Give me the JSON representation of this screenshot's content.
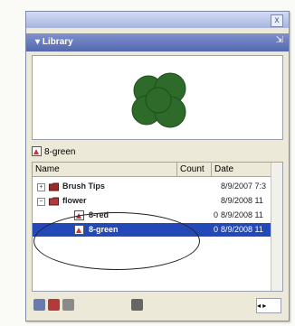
{
  "panel": {
    "title": "Library",
    "close_label": "x",
    "options_label": "⇲"
  },
  "selected_item": {
    "name": "8-green"
  },
  "columns": {
    "name": "Name",
    "count": "Count",
    "date": "Date"
  },
  "rows": [
    {
      "name": "Brush Tips",
      "count": "",
      "date": "8/9/2007 7:3",
      "type": "folder",
      "expander": "+"
    },
    {
      "name": "flower",
      "count": "",
      "date": "8/9/2008 11",
      "type": "folder",
      "expander": "−"
    },
    {
      "name": "8-red",
      "count": "0",
      "date": "8/9/2008 11",
      "type": "symbol"
    },
    {
      "name": "8-green",
      "count": "0",
      "date": "8/9/2008 11",
      "type": "symbol",
      "selected": true
    }
  ],
  "colors": {
    "selection": "#2349b8",
    "panel_header": "#6274bc",
    "leaf": "#2e6b2a",
    "annotation": "#222222"
  }
}
